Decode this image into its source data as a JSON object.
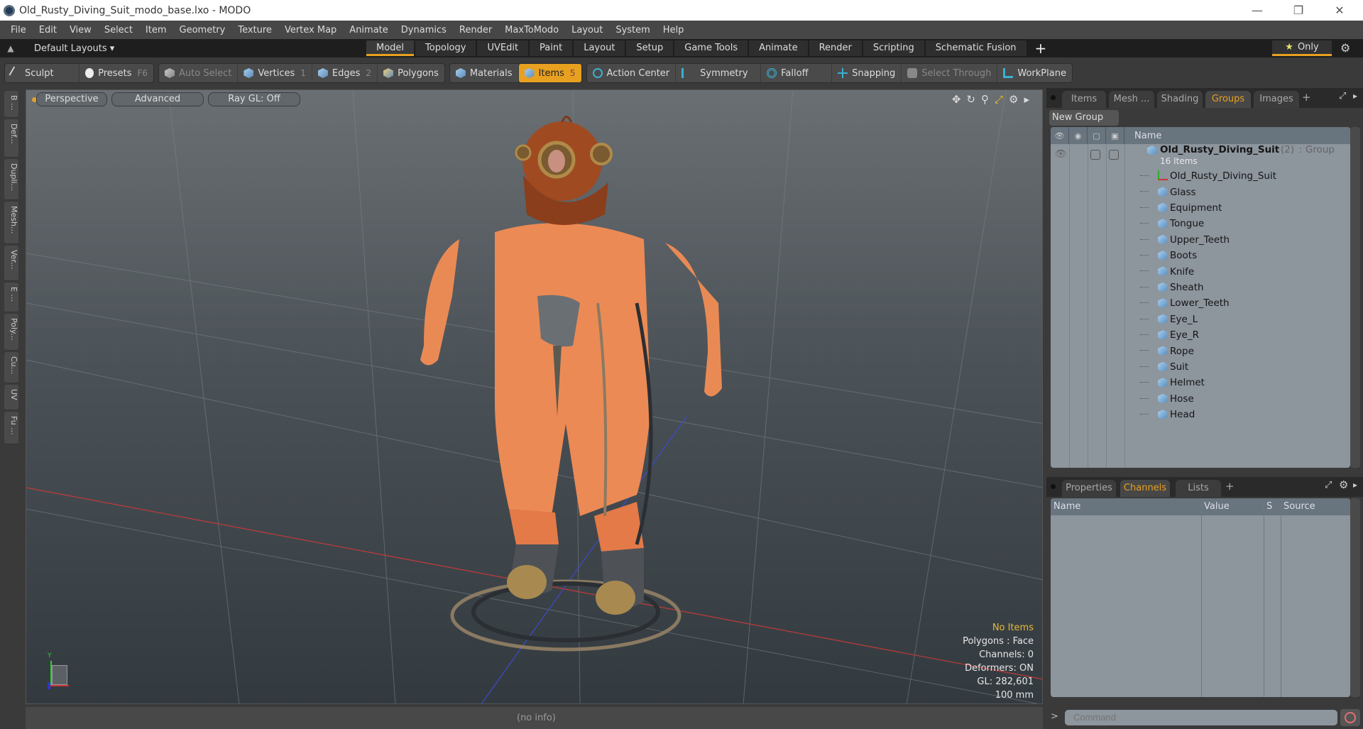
{
  "window": {
    "title": "Old_Rusty_Diving_Suit_modo_base.lxo - MODO",
    "controls": {
      "minimize": "—",
      "restore": "❐",
      "close": "✕"
    }
  },
  "menu": [
    "File",
    "Edit",
    "View",
    "Select",
    "Item",
    "Geometry",
    "Texture",
    "Vertex Map",
    "Animate",
    "Dynamics",
    "Render",
    "MaxToModo",
    "Layout",
    "System",
    "Help"
  ],
  "layout_bar": {
    "selector": "Default Layouts ▾",
    "tabs": [
      "Model",
      "Topology",
      "UVEdit",
      "Paint",
      "Layout",
      "Setup",
      "Game Tools",
      "Animate",
      "Render",
      "Scripting",
      "Schematic Fusion"
    ],
    "active_tab": "Model",
    "add": "+",
    "only_label": "Only"
  },
  "toolbar": {
    "sculpt": "Sculpt",
    "presets": "Presets",
    "presets_key": "F6",
    "auto_select": "Auto Select",
    "vertices": "Vertices",
    "vertices_num": "1",
    "edges": "Edges",
    "edges_num": "2",
    "polygons": "Polygons",
    "materials": "Materials",
    "items": "Items",
    "items_num": "5",
    "action_center": "Action Center",
    "symmetry": "Symmetry",
    "falloff": "Falloff",
    "snapping": "Snapping",
    "select_through": "Select Through",
    "workplane": "WorkPlane"
  },
  "left_tabs": [
    "B ...",
    "Def...",
    "Dupli...",
    "Mesh...",
    "Ver...",
    "E ...",
    "Poly...",
    "Cu...",
    "UV",
    "Fu ..."
  ],
  "viewport": {
    "view": "Perspective",
    "shading": "Advanced",
    "raygl": "Ray GL: Off",
    "info": {
      "selection": "No Items",
      "polygons": "Polygons : Face",
      "channels": "Channels: 0",
      "deformers": "Deformers: ON",
      "gl": "GL: 282,601",
      "unit": "100 mm"
    },
    "axis_label": "Y"
  },
  "status": {
    "info": "(no info)"
  },
  "groups_panel": {
    "tabs": [
      "Items",
      "Mesh ...",
      "Shading",
      "Groups",
      "Images"
    ],
    "active_tab": "Groups",
    "new_group": "New Group",
    "header_name": "Name",
    "group": {
      "name": "Old_Rusty_Diving_Suit",
      "count": "(2)",
      "type": ": Group",
      "sub": "16 Items"
    },
    "items": [
      "Old_Rusty_Diving_Suit",
      "Glass",
      "Equipment",
      "Tongue",
      "Upper_Teeth",
      "Boots",
      "Knife",
      "Sheath",
      "Lower_Teeth",
      "Eye_L",
      "Eye_R",
      "Rope",
      "Suit",
      "Helmet",
      "Hose",
      "Head"
    ]
  },
  "channels_panel": {
    "tabs": [
      "Properties",
      "Channels",
      "Lists"
    ],
    "active_tab": "Channels",
    "columns": [
      "Name",
      "Value",
      "S",
      "Source"
    ]
  },
  "command": {
    "prompt": ">",
    "placeholder": "Command"
  }
}
